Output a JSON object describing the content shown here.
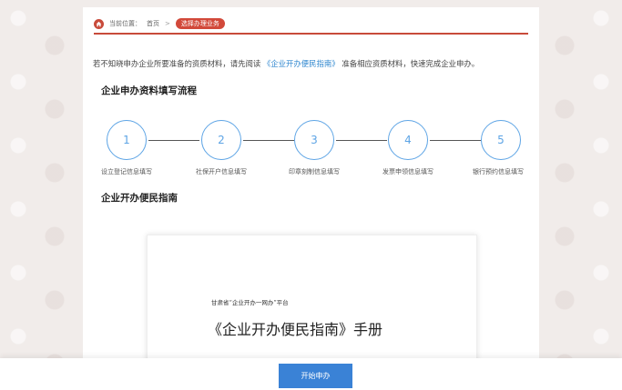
{
  "breadcrumb": {
    "prefix": "当前位置：",
    "home": "首页",
    "separator": ">",
    "current": "选择办理业务"
  },
  "notice": {
    "before": "若不知晓申办企业所要准备的资质材料，请先阅读",
    "link": "《企业开办便民指南》",
    "after": "准备相应资质材料，快速完成企业申办。"
  },
  "process": {
    "title": "企业申办资料填写流程",
    "steps": [
      {
        "number": "1",
        "label": "设立登记信息填写"
      },
      {
        "number": "2",
        "label": "社保开户信息填写"
      },
      {
        "number": "3",
        "label": "印章刻制信息填写"
      },
      {
        "number": "4",
        "label": "发票申领信息填写"
      },
      {
        "number": "5",
        "label": "银行预约信息填写"
      }
    ]
  },
  "guide": {
    "title": "企业开办便民指南",
    "doc_subtitle": "甘肃省“企业开办一网办”平台",
    "doc_title": "《企业开办便民指南》手册"
  },
  "footer": {
    "start_label": "开始申办"
  },
  "colors": {
    "accent_red": "#d2493a",
    "step_blue": "#5da4e5",
    "button_blue": "#3a82d6",
    "link_blue": "#2f87cf"
  }
}
